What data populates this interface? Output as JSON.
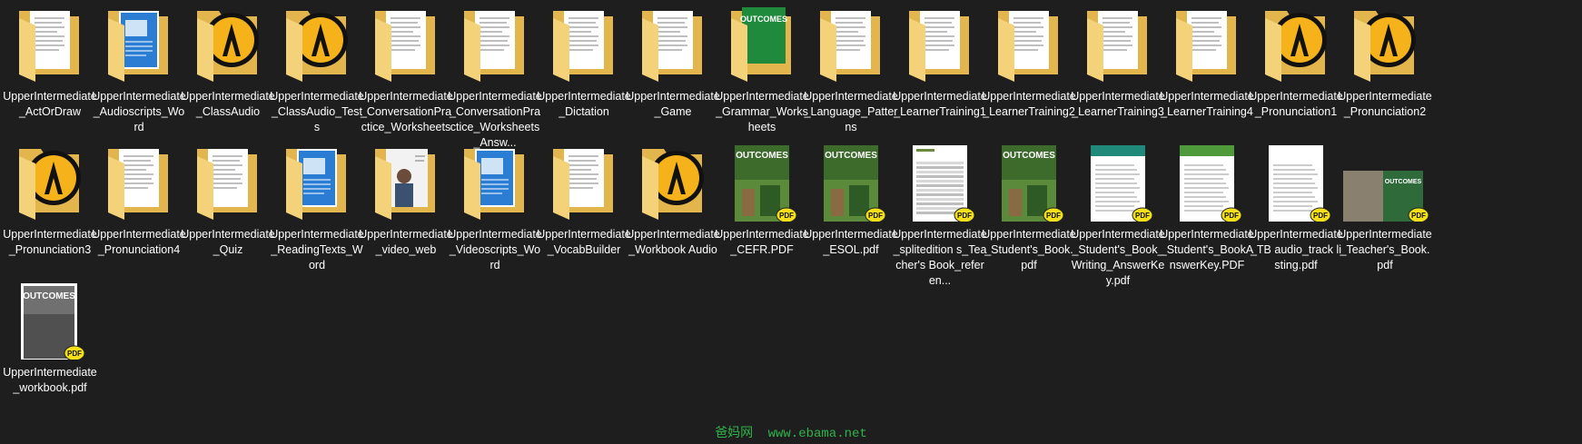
{
  "items": [
    {
      "label": "UpperIntermediate_ActOrDraw",
      "type": "folder",
      "inner": "doc"
    },
    {
      "label": "UpperIntermediate_Audioscripts_Word",
      "type": "folder",
      "inner": "word"
    },
    {
      "label": "UpperIntermediate_ClassAudio",
      "type": "folder",
      "inner": "audio"
    },
    {
      "label": "UpperIntermediate_ClassAudio_Tests",
      "type": "folder",
      "inner": "audio"
    },
    {
      "label": "UpperIntermediate_ConversationPractice_Worksheets",
      "type": "folder",
      "inner": "doc"
    },
    {
      "label": "UpperIntermediate_ConversationPractice_Worksheets_Answ...",
      "type": "folder",
      "inner": "doc"
    },
    {
      "label": "UpperIntermediate_Dictation",
      "type": "folder",
      "inner": "doc"
    },
    {
      "label": "UpperIntermediate_Game",
      "type": "folder",
      "inner": "doc"
    },
    {
      "label": "UpperIntermediate_Grammar_Worksheets",
      "type": "folder",
      "inner": "outcomes"
    },
    {
      "label": "UpperIntermediate_Language_Patterns",
      "type": "folder",
      "inner": "doc"
    },
    {
      "label": "UpperIntermediate_LearnerTraining1",
      "type": "folder",
      "inner": "doc"
    },
    {
      "label": "UpperIntermediate_LearnerTraining2",
      "type": "folder",
      "inner": "doc"
    },
    {
      "label": "UpperIntermediate_LearnerTraining3",
      "type": "folder",
      "inner": "doc"
    },
    {
      "label": "UpperIntermediate_LearnerTraining4",
      "type": "folder",
      "inner": "doc"
    },
    {
      "label": "UpperIntermediate_Pronunciation1",
      "type": "folder",
      "inner": "audio"
    },
    {
      "label": "UpperIntermediate_Pronunciation2",
      "type": "folder",
      "inner": "audio"
    },
    {
      "label": "UpperIntermediate_Pronunciation3",
      "type": "folder",
      "inner": "audio"
    },
    {
      "label": "UpperIntermediate_Pronunciation4",
      "type": "folder",
      "inner": "doc"
    },
    {
      "label": "UpperIntermediate_Quiz",
      "type": "folder",
      "inner": "doc"
    },
    {
      "label": "UpperIntermediate_ReadingTexts_Word",
      "type": "folder",
      "inner": "word"
    },
    {
      "label": "UpperIntermediate_video_web",
      "type": "folder",
      "inner": "video"
    },
    {
      "label": "UpperIntermediate_Videoscripts_Word",
      "type": "folder",
      "inner": "word"
    },
    {
      "label": "UpperIntermediate_VocabBuilder",
      "type": "folder",
      "inner": "doc"
    },
    {
      "label": "UpperIntermediate_Workbook Audio",
      "type": "folder",
      "inner": "audio"
    },
    {
      "label": "UpperIntermediate_CEFR.PDF",
      "type": "pdf",
      "inner": "cover"
    },
    {
      "label": "UpperIntermediate_ESOL.pdf",
      "type": "pdf",
      "inner": "cover"
    },
    {
      "label": "UpperIntermediate_splitedition s_Teacher's Book_referen...",
      "type": "pdf",
      "inner": "table"
    },
    {
      "label": "UpperIntermediate_Student's_Book.pdf",
      "type": "pdf",
      "inner": "cover"
    },
    {
      "label": "UpperIntermediate_Student's_Book_Writing_AnswerKey.pdf",
      "type": "pdf",
      "inner": "teal"
    },
    {
      "label": "UpperIntermediate_Student's_BookAnswerKey.PDF",
      "type": "pdf",
      "inner": "green"
    },
    {
      "label": "UpperIntermediate_TB audio_track listing.pdf",
      "type": "pdf",
      "inner": "list"
    },
    {
      "label": "UpperIntermediate_Teacher's_Book.pdf",
      "type": "pdf",
      "inner": "wide"
    },
    {
      "label": "UpperIntermediate_workbook.pdf",
      "type": "pdf",
      "inner": "gray"
    }
  ],
  "cover_title": "OUTCOMES",
  "badge_text": "PDF",
  "watermark": {
    "cn": "爸妈网",
    "url": "www.ebama.net"
  },
  "colors": {
    "background": "#1e1e1e",
    "folder": "#f3d27a",
    "folder_back": "#e2b64c",
    "audio": "#f6b21a",
    "word": "#2b7cd3",
    "pdf_badge": "#f3e01a",
    "cover_green": "#3d6b2c",
    "watermark": "#2fb34a"
  }
}
